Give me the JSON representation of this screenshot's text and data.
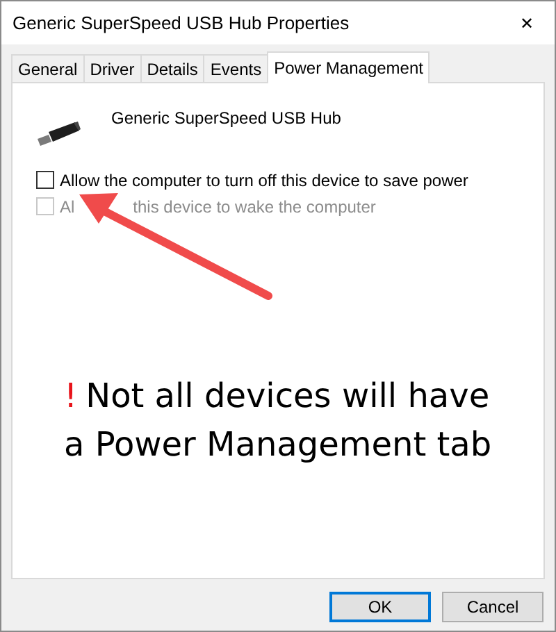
{
  "window": {
    "title": "Generic SuperSpeed USB Hub Properties",
    "close": "✕"
  },
  "tabs": [
    {
      "label": "General",
      "selected": false
    },
    {
      "label": "Driver",
      "selected": false
    },
    {
      "label": "Details",
      "selected": false
    },
    {
      "label": "Events",
      "selected": false
    },
    {
      "label": "Power Management",
      "selected": true
    }
  ],
  "device": {
    "name": "Generic SuperSpeed USB Hub"
  },
  "options": [
    {
      "label": "Allow the computer to turn off this device to save power",
      "checked": false,
      "disabled": false
    },
    {
      "label_parts": [
        "Al",
        "this device to wake the computer"
      ],
      "checked": false,
      "disabled": true
    }
  ],
  "note": {
    "mark": "!",
    "text": "Not all devices will have a Power Management tab"
  },
  "buttons": [
    {
      "label": "OK",
      "default": true
    },
    {
      "label": "Cancel",
      "default": false
    }
  ]
}
